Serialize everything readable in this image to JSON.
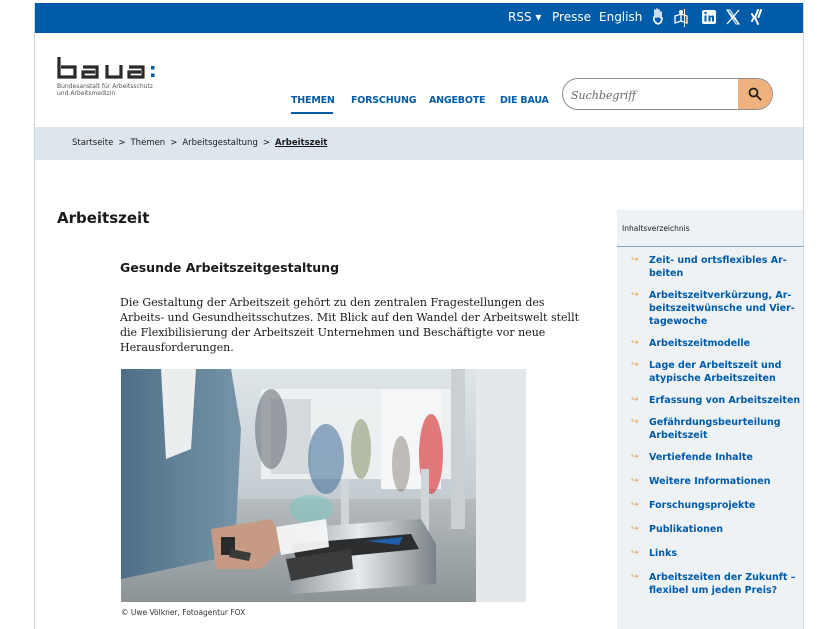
{
  "topbar": {
    "rss": "RSS ▾",
    "presse": "Presse",
    "english": "English"
  },
  "logo": {
    "name": "baua:",
    "subtitle_line1": "Bundesanstalt für Arbeitsschutz",
    "subtitle_line2": "und Arbeitsmedizin"
  },
  "nav": {
    "items": [
      "THEMEN",
      "FORSCHUNG",
      "ANGEBOTE",
      "DIE BAUA"
    ]
  },
  "search": {
    "placeholder": "Suchbegriff"
  },
  "breadcrumb": {
    "items": [
      "Startseite",
      "Themen",
      "Arbeitsgestaltung"
    ],
    "current": "Arbeitszeit",
    "separator": ">"
  },
  "main": {
    "title": "Arbeitszeit",
    "subheading": "Gesunde Arbeitszeitgestaltung",
    "intro": "Die Gestaltung der Arbeitszeit gehört zu den zentralen Fragestellungen des Arbeits- und Gesundheitsschutzes. Mit Blick auf den Wandel der Arbeitswelt stellt die Flexibilisierung der Arbeitszeit Unternehmen und Beschäftigte vor neue Herausforderungen.",
    "caption": "© Uwe Völkner, Fotoagentur FOX"
  },
  "toc": {
    "heading": "Inhaltsverzeichnis",
    "items": [
      "Zeit- und ortsflexibles Ar­beiten",
      "Arbeitszeitverkürzung, Ar­beitszeitwünsche und Vier­tagewoche",
      "Arbeitszeitmodelle",
      "Lage der Arbeitszeit und atypische Arbeitszeiten",
      "Erfassung von Arbeitszeiten",
      "Gefährdungsbeurteilung Ar­beitszeit",
      "Vertiefende Inhalte",
      "Weitere Informationen",
      "Forschungsprojekte",
      "Publikationen",
      "Links",
      "Arbeitszeiten der Zukunft – flexibel um jeden Preis?"
    ]
  },
  "colors": {
    "brand_blue": "#005ca9",
    "accent_orange": "#f0b27c",
    "breadcrumb_bg": "#dde6ed",
    "toc_bg": "#eef2f5"
  }
}
